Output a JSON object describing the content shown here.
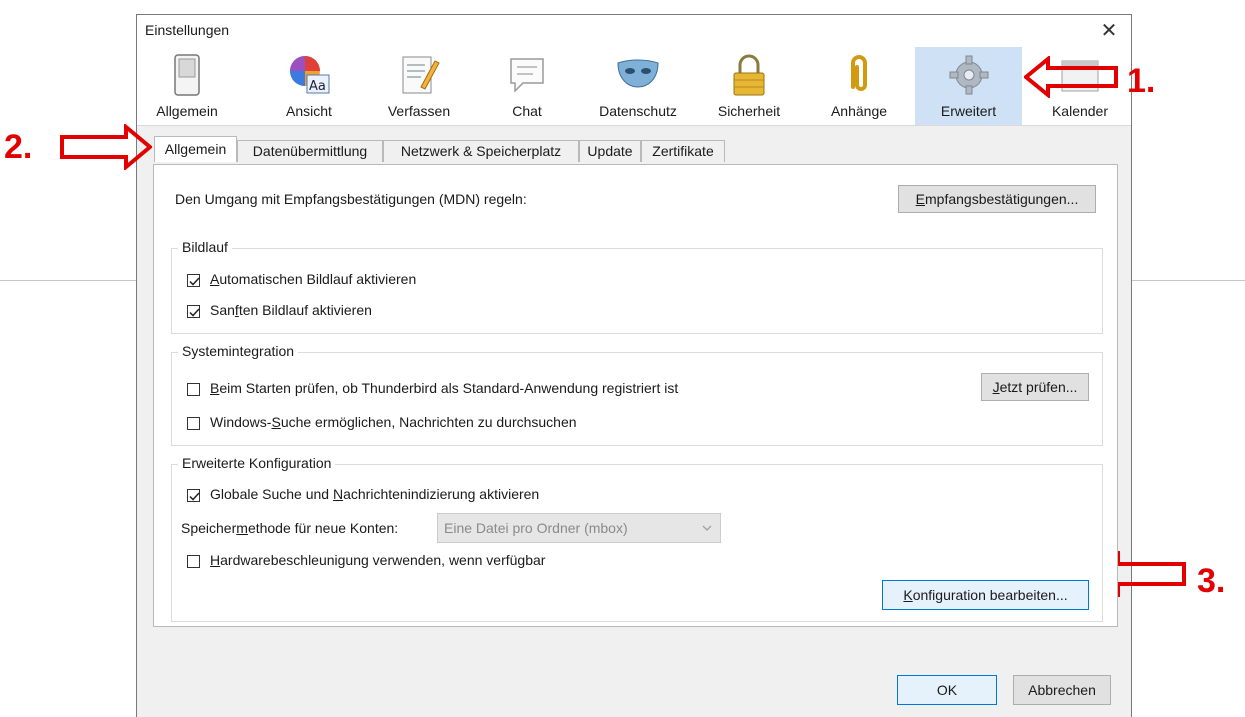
{
  "window": {
    "title": "Einstellungen",
    "close_glyph": "✕"
  },
  "toolbar": {
    "items": [
      {
        "label": "Allgemein",
        "icon": "switch-icon"
      },
      {
        "label": "Ansicht",
        "icon": "color-font-icon"
      },
      {
        "label": "Verfassen",
        "icon": "compose-icon"
      },
      {
        "label": "Chat",
        "icon": "chat-bubble-icon"
      },
      {
        "label": "Datenschutz",
        "icon": "mask-icon"
      },
      {
        "label": "Sicherheit",
        "icon": "padlock-icon"
      },
      {
        "label": "Anhänge",
        "icon": "paperclip-icon"
      },
      {
        "label": "Erweitert",
        "icon": "gear-icon",
        "selected": true
      },
      {
        "label": "Kalender",
        "icon": "calendar-icon"
      }
    ]
  },
  "tabs": [
    {
      "label": "Allgemein",
      "active": true
    },
    {
      "label": "Datenübermittlung"
    },
    {
      "label": "Netzwerk & Speicherplatz"
    },
    {
      "label": "Update"
    },
    {
      "label": "Zertifikate"
    }
  ],
  "panel": {
    "mdn": {
      "label": "Den Umgang mit Empfangsbestätigungen (MDN) regeln:",
      "button_pre": "E",
      "button_rest": "mpfangsbestätigungen..."
    },
    "bildlauf": {
      "title": "Bildlauf",
      "auto": {
        "checked": true,
        "pre": "",
        "u": "A",
        "rest": "utomatischen Bildlauf aktivieren"
      },
      "smooth": {
        "checked": true,
        "pre": "San",
        "u": "f",
        "rest": "ten Bildlauf aktivieren"
      }
    },
    "system": {
      "title": "Systemintegration",
      "startup": {
        "checked": false,
        "pre": "",
        "u": "B",
        "rest": "eim Starten prüfen, ob Thunderbird als Standard-Anwendung registriert ist"
      },
      "check_btn_pre": "J",
      "check_btn_rest": "etzt prüfen...",
      "search": {
        "checked": false,
        "pre": "Windows-",
        "u": "S",
        "rest": "uche ermöglichen, Nachrichten zu durchsuchen"
      }
    },
    "advanced": {
      "title": "Erweiterte Konfiguration",
      "global": {
        "checked": true,
        "pre": "Globale Suche und ",
        "u": "N",
        "rest": "achrichtenindizierung aktivieren"
      },
      "storage_pre": "Speicher",
      "storage_u": "m",
      "storage_rest": "ethode für neue Konten:",
      "storage_value": "Eine Datei pro Ordner (mbox)",
      "hw": {
        "checked": false,
        "pre": "",
        "u": "H",
        "rest": "ardwarebeschleunigung verwenden, wenn verfügbar"
      },
      "config_btn_pre": "K",
      "config_btn_rest": "onfiguration bearbeiten..."
    }
  },
  "footer": {
    "ok": "OK",
    "cancel": "Abbrechen"
  },
  "annotations": {
    "a1": "1.",
    "a2": "2.",
    "a3": "3.",
    "color": "#e30000"
  }
}
